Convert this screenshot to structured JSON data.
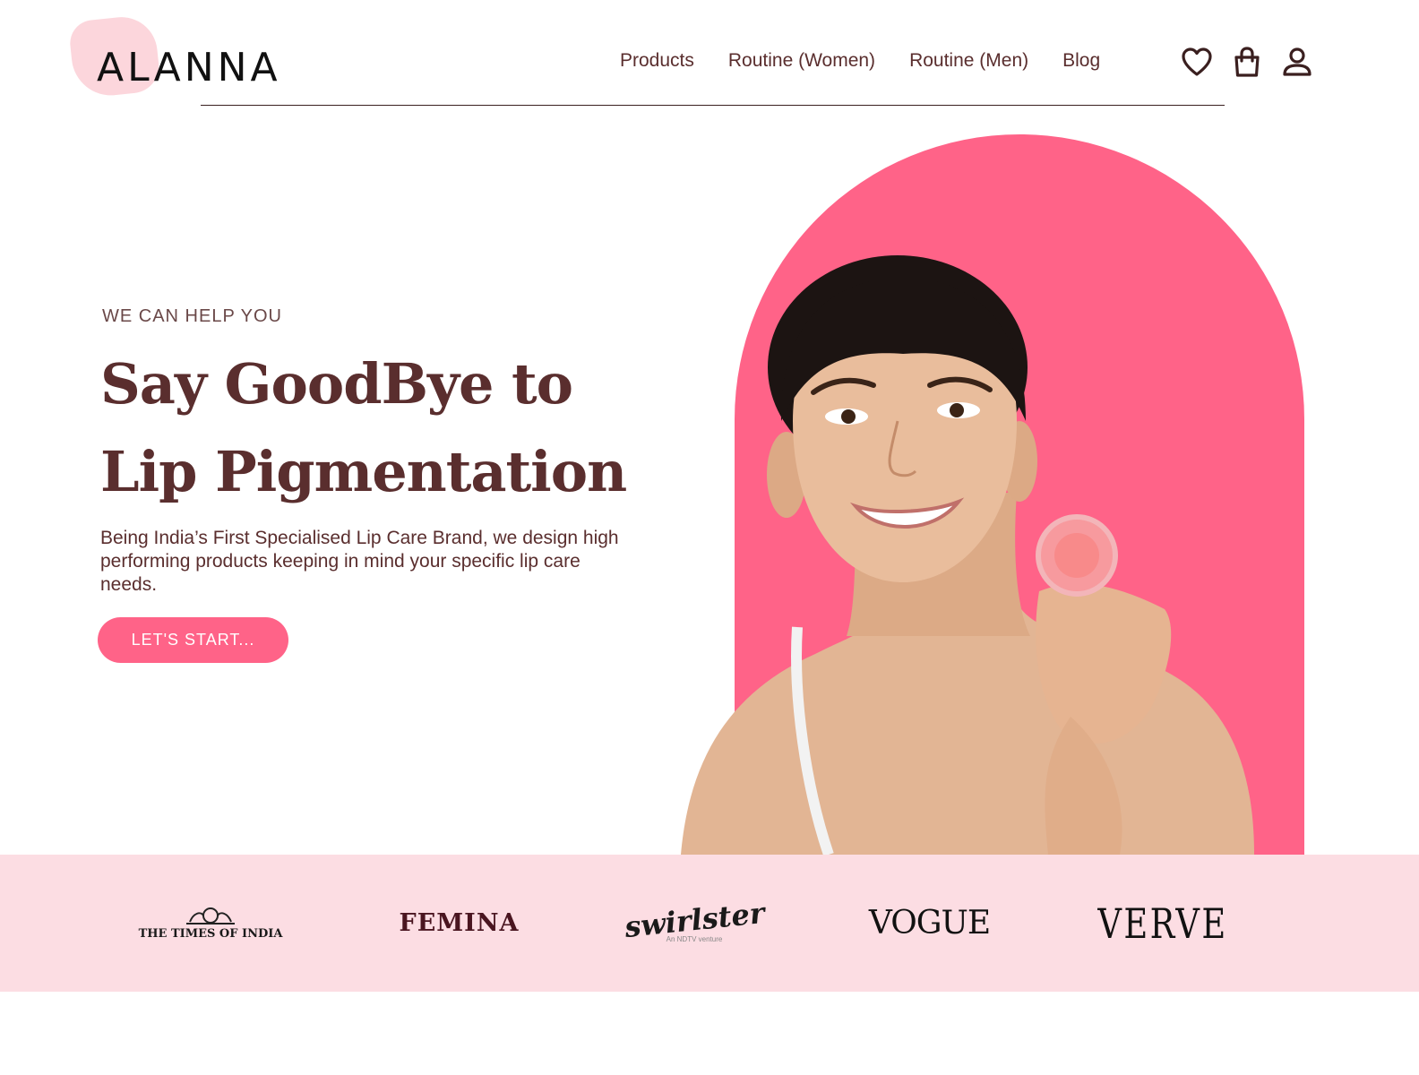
{
  "brand": {
    "name": "ALANNA"
  },
  "nav": {
    "items": [
      {
        "label": "Products"
      },
      {
        "label": "Routine (Women)"
      },
      {
        "label": "Routine (Men)"
      },
      {
        "label": "Blog"
      }
    ],
    "icons": [
      "heart-icon",
      "shopping-bag-icon",
      "user-icon"
    ]
  },
  "hero": {
    "eyebrow": "WE CAN HELP YOU",
    "headline_line1": "Say GoodBye to",
    "headline_line2": "Lip Pigmentation",
    "description": "Being India’s First Specialised Lip Care Brand, we design high performing products keeping in mind your specific lip care needs.",
    "cta_label": "LET'S START..."
  },
  "press": {
    "logos": [
      {
        "name": "THE TIMES OF INDIA"
      },
      {
        "name": "FEMINA"
      },
      {
        "name": "swirlster",
        "tagline": "An NDTV venture"
      },
      {
        "name": "VOGUE"
      },
      {
        "name": "VERVE"
      }
    ]
  },
  "colors": {
    "accent": "#ff6388",
    "text": "#5a2e2e",
    "press_band": "#fcdde3",
    "logo_blob": "#fbcfd6"
  }
}
